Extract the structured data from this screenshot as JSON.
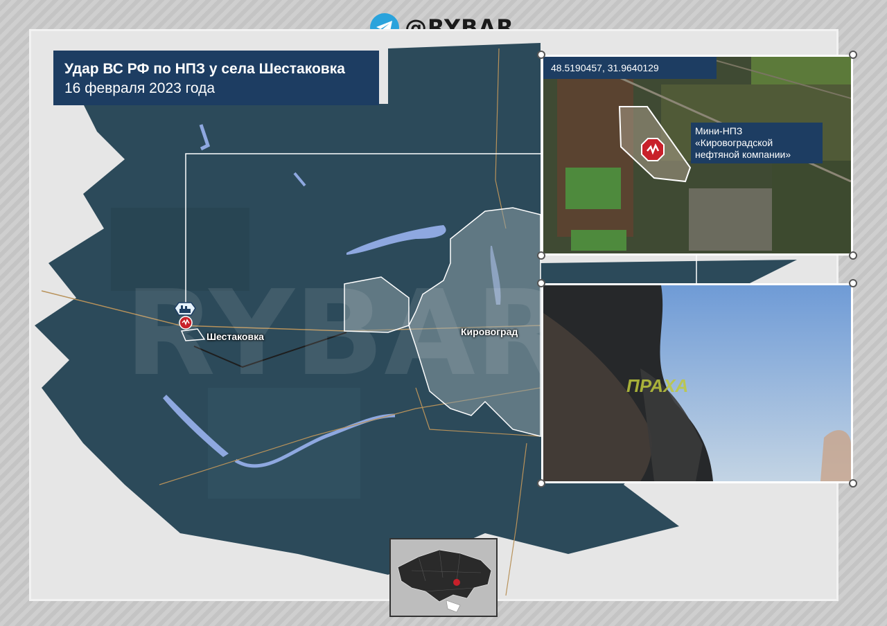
{
  "brand": {
    "handle": "@RYBAR",
    "icon": "telegram-icon"
  },
  "title": {
    "line1": "Удар ВС РФ по НПЗ у села Шестаковка",
    "line2": "16 февраля 2023 года"
  },
  "places": {
    "village": "Шестаковка",
    "city": "Кировоград"
  },
  "inset_satellite": {
    "coordinates": "48.5190457, 31.9640129",
    "label_lines": [
      "Мини-НПЗ",
      "«Кировоградской",
      "нефтяной компании»"
    ],
    "marker": "explosion-icon"
  },
  "inset_photo": {
    "watermark": "ПРАХА"
  },
  "markers": {
    "refinery": "factory-icon",
    "strike": "explosion-icon"
  },
  "colors": {
    "title_bg": "#1d3d62",
    "map_dark": "#2c4a5a",
    "water": "#8ea8e0",
    "strike_red": "#c8202a",
    "brand_blue": "#2aa3dc"
  }
}
